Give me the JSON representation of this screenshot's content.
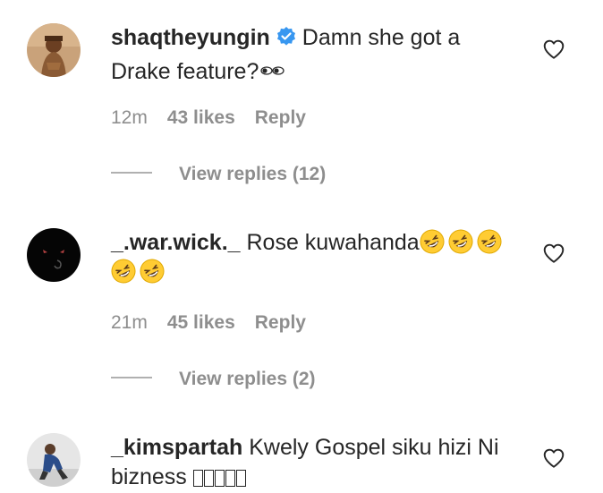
{
  "comments": [
    {
      "username": "shaqtheyungin",
      "verified": true,
      "text": "Damn she got a Drake feature?",
      "trailing_emoji": [
        "eyes-emoji"
      ],
      "time": "12m",
      "likes": "43 likes",
      "reply": "Reply",
      "view_replies": "View replies (12)"
    },
    {
      "username": "_.war.wick._",
      "verified": false,
      "text": "Rose kuwahanda",
      "trailing_emoji": [
        "rofl-emoji",
        "rofl-emoji",
        "rofl-emoji",
        "rofl-emoji",
        "rofl-emoji"
      ],
      "time": "21m",
      "likes": "45 likes",
      "reply": "Reply",
      "view_replies": "View replies (2)"
    },
    {
      "username": "_kimspartah",
      "verified": false,
      "text": "Kwely Gospel siku hizi Ni bizness",
      "trailing_emoji": [
        "missing-glyph",
        "missing-glyph",
        "missing-glyph",
        "missing-glyph",
        "missing-glyph"
      ]
    }
  ],
  "icons": {
    "like": "heart-outline-icon",
    "verified": "verified-badge-icon"
  },
  "colors": {
    "text": "#262626",
    "muted": "#8e8e8e",
    "verified": "#3897f0",
    "emoji_face": "#ffcc33"
  }
}
